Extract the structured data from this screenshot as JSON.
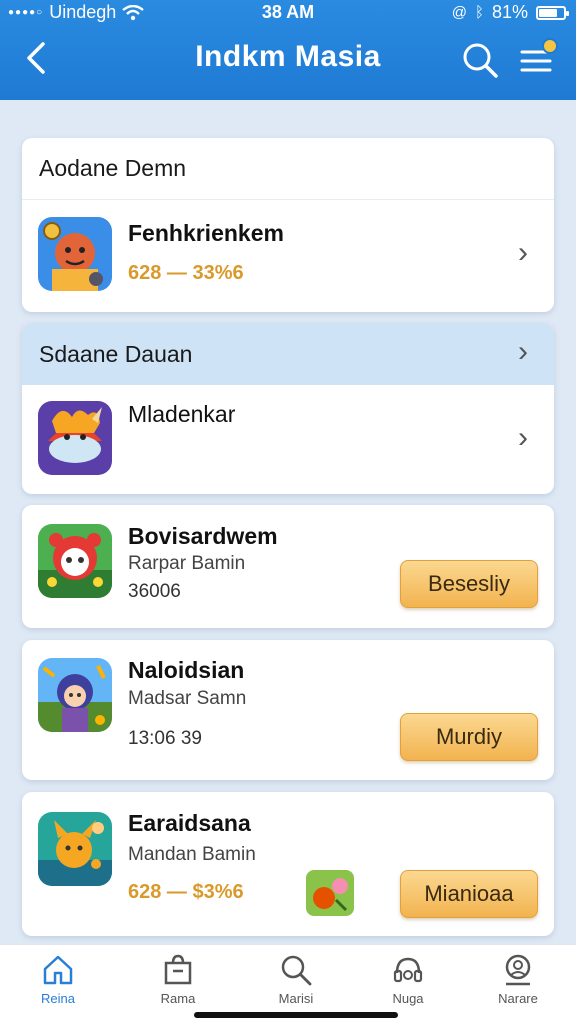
{
  "status_bar": {
    "carrier": "Uindegh",
    "time": "38 AM",
    "battery": "81%"
  },
  "header": {
    "title": "Indkm Masia"
  },
  "section1": {
    "title": "Aodane Demn",
    "app": {
      "name": "Fenhkrienkem",
      "price": "628 — 33%6"
    }
  },
  "section2": {
    "title": "Sdaane Dauan",
    "app": {
      "name": "Mladenkar"
    }
  },
  "apps": [
    {
      "name": "Bovisardwem",
      "subtitle": "Rarpar Bamin",
      "meta": "36006",
      "button": "Besesliy"
    },
    {
      "name": "Naloidsian",
      "subtitle": "Madsar Samn",
      "meta": "13:06 39",
      "button": "Murdiy"
    },
    {
      "name": "Earaidsana",
      "subtitle": "Mandan Bamin",
      "price": "628 — $3%6",
      "button": "Mianioaa"
    }
  ],
  "nav": [
    {
      "label": "Reina",
      "icon": "home-icon"
    },
    {
      "label": "Rama",
      "icon": "bag-icon"
    },
    {
      "label": "Marisi",
      "icon": "search-icon"
    },
    {
      "label": "Nuga",
      "icon": "headset-icon"
    },
    {
      "label": "Narare",
      "icon": "profile-icon"
    }
  ],
  "colors": {
    "header": "#1f7ad4",
    "accent_button": "#f2b34f",
    "price": "#d99a2b",
    "active_nav": "#2a7fd4"
  }
}
